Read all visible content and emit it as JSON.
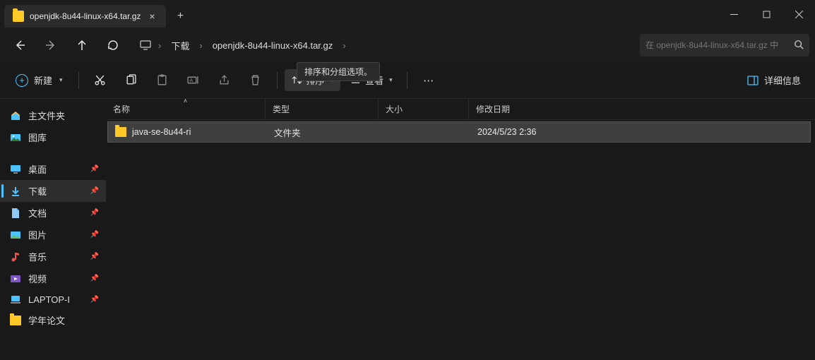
{
  "tab": {
    "title": "openjdk-8u44-linux-x64.tar.gz"
  },
  "breadcrumbs": {
    "b1": "下载",
    "b2": "openjdk-8u44-linux-x64.tar.gz"
  },
  "search": {
    "placeholder": "在 openjdk-8u44-linux-x64.tar.gz 中"
  },
  "toolbar": {
    "new": "新建",
    "sort": "排序",
    "view": "查看",
    "details": "详细信息",
    "tooltip": "排序和分组选项。"
  },
  "sidebar": {
    "home": "主文件夹",
    "gallery": "图库",
    "desktop": "桌面",
    "downloads": "下载",
    "documents": "文档",
    "pictures": "图片",
    "music": "音乐",
    "videos": "视频",
    "laptop": "LAPTOP-I",
    "papers": "学年论文"
  },
  "columns": {
    "name": "名称",
    "type": "类型",
    "size": "大小",
    "date": "修改日期"
  },
  "rows": [
    {
      "name": "java-se-8u44-ri",
      "type": "文件夹",
      "size": "",
      "date": "2024/5/23 2:36"
    }
  ]
}
